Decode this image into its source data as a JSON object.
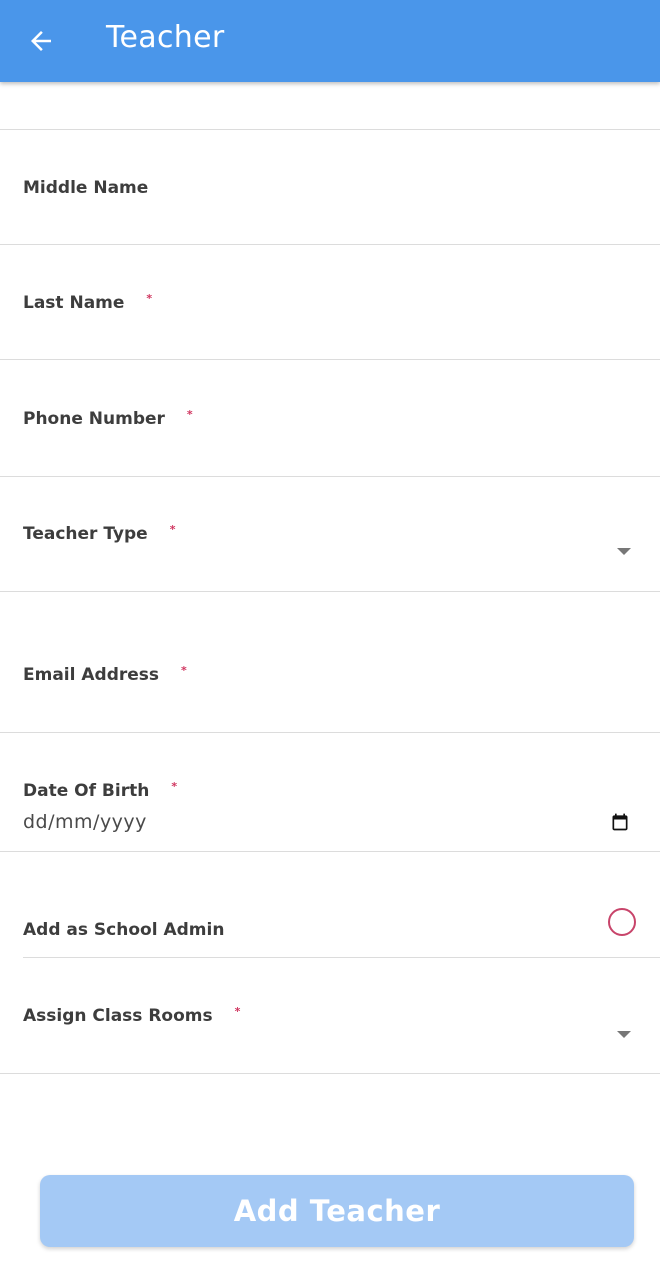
{
  "appbar": {
    "title": "Teacher",
    "back_icon": "arrow-left-icon"
  },
  "form": {
    "middle_name": {
      "label": "Middle Name",
      "value": ""
    },
    "last_name": {
      "label": "Last Name",
      "required_mark": "*",
      "value": ""
    },
    "phone_number": {
      "label": "Phone Number",
      "required_mark": "*",
      "value": ""
    },
    "teacher_type": {
      "label": "Teacher Type",
      "required_mark": "*",
      "selected": ""
    },
    "email_address": {
      "label": "Email Address",
      "required_mark": "*",
      "value": ""
    },
    "date_of_birth": {
      "label": "Date Of Birth",
      "required_mark": "*",
      "placeholder": "dd/mm/yyyy"
    },
    "school_admin": {
      "label": "Add as School Admin",
      "checked": false
    },
    "class_rooms": {
      "label": "Assign Class Rooms",
      "required_mark": "*",
      "selected": ""
    }
  },
  "submit": {
    "label": "Add Teacher"
  },
  "colors": {
    "primary": "#4a96ea",
    "button_disabled": "#a4c9f5",
    "required": "#d0355f",
    "radio": "#c8446a"
  }
}
